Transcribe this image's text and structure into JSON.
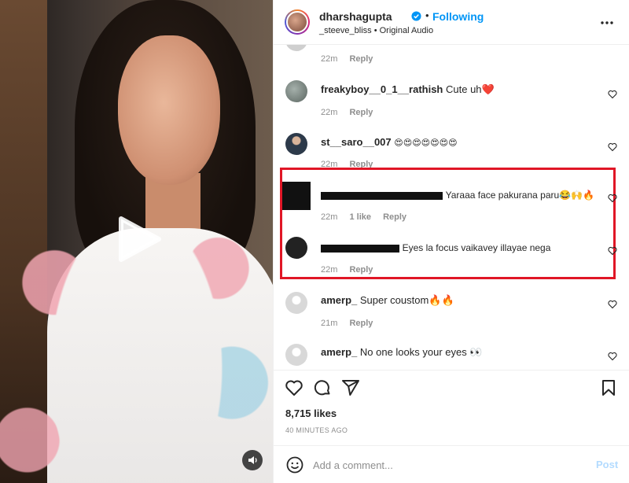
{
  "header": {
    "username": "dharshagupta",
    "separator": "•",
    "follow_label": "Following",
    "subtitle": "_steeve_bliss • Original Audio"
  },
  "comments": [
    {
      "username": "",
      "text": "",
      "time": "22m",
      "likes": "",
      "reply": "Reply",
      "avatar_color": "#cfcfcf"
    },
    {
      "username": "freakyboy__0_1__rathish",
      "text": "Cute uh❤️",
      "time": "22m",
      "likes": "",
      "reply": "Reply",
      "avatar_color": "#7f8a86"
    },
    {
      "username": "st__saro__007",
      "text": "😍😍😍😍😍😍😍",
      "time": "22m",
      "likes": "",
      "reply": "Reply",
      "avatar_color": "#4a5a6a"
    },
    {
      "username": "",
      "text": "Yaraaa face pakurana paru😂🙌🔥",
      "time": "22m",
      "likes": "1 like",
      "reply": "Reply",
      "avatar_color": "#111111"
    },
    {
      "username": "",
      "text": "Eyes la focus vaikavey illayae nega",
      "time": "22m",
      "likes": "",
      "reply": "Reply",
      "avatar_color": "#222222"
    },
    {
      "username": "amerp_",
      "text": "Super coustom🔥🔥",
      "time": "21m",
      "likes": "",
      "reply": "Reply",
      "avatar_color": "#d8d8d8"
    },
    {
      "username": "amerp_",
      "text": "No one looks your eyes 👀",
      "time": "",
      "likes": "",
      "reply": "",
      "avatar_color": "#d8d8d8"
    }
  ],
  "likes_text": "8,715 likes",
  "posted_ago": "40 MINUTES AGO",
  "composer": {
    "placeholder": "Add a comment...",
    "post_label": "Post"
  },
  "icons": {
    "verified": "verified-badge-icon",
    "more": "more-options-icon",
    "like": "heart-icon",
    "comment": "comment-icon",
    "share": "share-icon",
    "save": "bookmark-icon",
    "emoji": "emoji-icon",
    "play": "play-icon",
    "audio": "audio-icon"
  },
  "colors": {
    "accent": "#0095f6",
    "highlight_box": "#e01626",
    "muted": "#8e8e8e"
  }
}
